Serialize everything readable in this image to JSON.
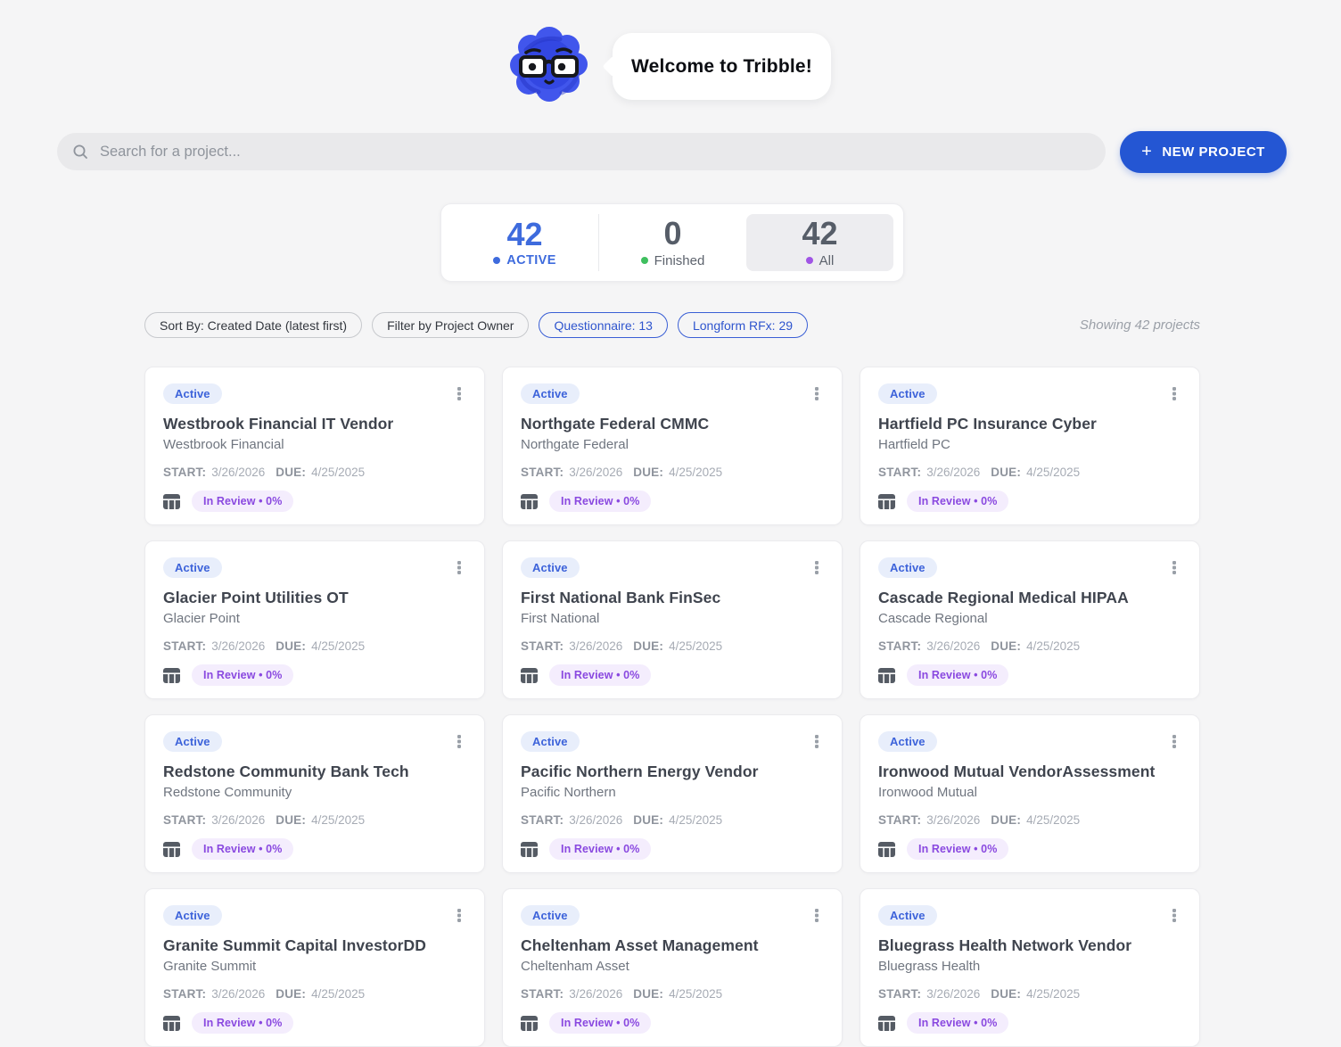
{
  "hero": {
    "welcome_text": "Welcome to Tribble!"
  },
  "search": {
    "placeholder": "Search for a project..."
  },
  "toolbar": {
    "plus": "+",
    "new_project_label": "NEW PROJECT"
  },
  "stats": {
    "items": [
      {
        "value": "42",
        "label": "ACTIVE",
        "dot_style": "background:#3e6bdd"
      },
      {
        "value": "0",
        "label": "Finished",
        "dot_style": "background:#3fbf5f"
      },
      {
        "value": "42",
        "label": "All",
        "dot_style": "background:#a055e5"
      }
    ]
  },
  "filters": {
    "sort_by": "Sort By: Created Date (latest first)",
    "owner": "Filter by Project Owner",
    "questionnaire": "Questionnaire: 13",
    "longform": "Longform RFx: 29",
    "showing": "Showing 42 projects"
  },
  "colors": {
    "primary_blue": "#2456d3",
    "active_stat_blue": "#3e6bdd",
    "finished_green": "#3fbf5f",
    "all_purple": "#a055e5",
    "badge_blue_text": "#3d63da",
    "badge_blue_bg": "#e8eefb",
    "progress_purple_text": "#8a49e0",
    "progress_purple_bg": "#f4edfd"
  },
  "cards": [
    {
      "status": "Active",
      "title": "Westbrook Financial IT Vendor",
      "subtitle": "Westbrook Financial",
      "start_label": "START:",
      "start_date": "3/26/2026",
      "due_label": "DUE:",
      "due_date": "4/25/2025",
      "progress": "In Review • 0%"
    },
    {
      "status": "Active",
      "title": "Northgate Federal CMMC",
      "subtitle": "Northgate Federal",
      "start_label": "START:",
      "start_date": "3/26/2026",
      "due_label": "DUE:",
      "due_date": "4/25/2025",
      "progress": "In Review • 0%"
    },
    {
      "status": "Active",
      "title": "Hartfield PC Insurance Cyber",
      "subtitle": "Hartfield PC",
      "start_label": "START:",
      "start_date": "3/26/2026",
      "due_label": "DUE:",
      "due_date": "4/25/2025",
      "progress": "In Review • 0%"
    },
    {
      "status": "Active",
      "title": "Glacier Point Utilities OT",
      "subtitle": "Glacier Point",
      "start_label": "START:",
      "start_date": "3/26/2026",
      "due_label": "DUE:",
      "due_date": "4/25/2025",
      "progress": "In Review • 0%"
    },
    {
      "status": "Active",
      "title": "First National Bank FinSec",
      "subtitle": "First National",
      "start_label": "START:",
      "start_date": "3/26/2026",
      "due_label": "DUE:",
      "due_date": "4/25/2025",
      "progress": "In Review • 0%"
    },
    {
      "status": "Active",
      "title": "Cascade Regional Medical HIPAA",
      "subtitle": "Cascade Regional",
      "start_label": "START:",
      "start_date": "3/26/2026",
      "due_label": "DUE:",
      "due_date": "4/25/2025",
      "progress": "In Review • 0%"
    },
    {
      "status": "Active",
      "title": "Redstone Community Bank Tech",
      "subtitle": "Redstone Community",
      "start_label": "START:",
      "start_date": "3/26/2026",
      "due_label": "DUE:",
      "due_date": "4/25/2025",
      "progress": "In Review • 0%"
    },
    {
      "status": "Active",
      "title": "Pacific Northern Energy Vendor",
      "subtitle": "Pacific Northern",
      "start_label": "START:",
      "start_date": "3/26/2026",
      "due_label": "DUE:",
      "due_date": "4/25/2025",
      "progress": "In Review • 0%"
    },
    {
      "status": "Active",
      "title": "Ironwood Mutual VendorAssessment",
      "subtitle": "Ironwood Mutual",
      "start_label": "START:",
      "start_date": "3/26/2026",
      "due_label": "DUE:",
      "due_date": "4/25/2025",
      "progress": "In Review • 0%"
    },
    {
      "status": "Active",
      "title": "Granite Summit Capital InvestorDD",
      "subtitle": "Granite Summit",
      "start_label": "START:",
      "start_date": "3/26/2026",
      "due_label": "DUE:",
      "due_date": "4/25/2025",
      "progress": "In Review • 0%"
    },
    {
      "status": "Active",
      "title": "Cheltenham Asset Management",
      "subtitle": "Cheltenham Asset",
      "start_label": "START:",
      "start_date": "3/26/2026",
      "due_label": "DUE:",
      "due_date": "4/25/2025",
      "progress": "In Review • 0%"
    },
    {
      "status": "Active",
      "title": "Bluegrass Health Network Vendor",
      "subtitle": "Bluegrass Health",
      "start_label": "START:",
      "start_date": "3/26/2026",
      "due_label": "DUE:",
      "due_date": "4/25/2025",
      "progress": "In Review • 0%"
    }
  ]
}
